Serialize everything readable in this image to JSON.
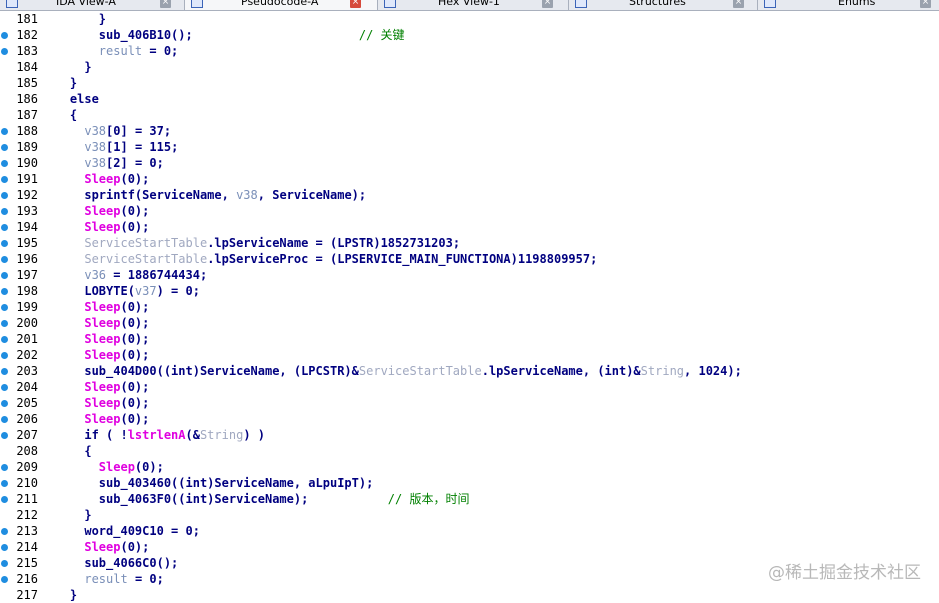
{
  "tabs": [
    {
      "label": "IDA View-A",
      "close": "×"
    },
    {
      "label": "Pseudocode-A",
      "close": "×"
    },
    {
      "label": "Hex View-1",
      "close": "×"
    },
    {
      "label": "Structures",
      "close": "×"
    },
    {
      "label": "Enums",
      "close": "×"
    }
  ],
  "lines": [
    {
      "n": "181",
      "bp": false,
      "t": [
        [
          "d",
          "        }"
        ]
      ]
    },
    {
      "n": "182",
      "bp": true,
      "t": [
        [
          "d",
          "        sub_406B10();"
        ],
        [
          "c",
          "                       // 关键"
        ]
      ]
    },
    {
      "n": "183",
      "bp": true,
      "t": [
        [
          "d",
          "        "
        ],
        [
          "v",
          "result"
        ],
        [
          "d",
          " = 0;"
        ]
      ]
    },
    {
      "n": "184",
      "bp": false,
      "t": [
        [
          "d",
          "      }"
        ]
      ]
    },
    {
      "n": "185",
      "bp": false,
      "t": [
        [
          "d",
          "    }"
        ]
      ]
    },
    {
      "n": "186",
      "bp": false,
      "t": [
        [
          "d",
          "    else"
        ]
      ]
    },
    {
      "n": "187",
      "bp": false,
      "t": [
        [
          "d",
          "    {"
        ]
      ]
    },
    {
      "n": "188",
      "bp": true,
      "t": [
        [
          "d",
          "      "
        ],
        [
          "v",
          "v38"
        ],
        [
          "d",
          "[0] = 37;"
        ]
      ]
    },
    {
      "n": "189",
      "bp": true,
      "t": [
        [
          "d",
          "      "
        ],
        [
          "v",
          "v38"
        ],
        [
          "d",
          "[1] = 115;"
        ]
      ]
    },
    {
      "n": "190",
      "bp": true,
      "t": [
        [
          "d",
          "      "
        ],
        [
          "v",
          "v38"
        ],
        [
          "d",
          "[2] = 0;"
        ]
      ]
    },
    {
      "n": "191",
      "bp": true,
      "t": [
        [
          "d",
          "      "
        ],
        [
          "f",
          "Sleep"
        ],
        [
          "d",
          "(0);"
        ]
      ]
    },
    {
      "n": "192",
      "bp": true,
      "t": [
        [
          "d",
          "      sprintf(ServiceName, "
        ],
        [
          "v",
          "v38"
        ],
        [
          "d",
          ", ServiceName);"
        ]
      ]
    },
    {
      "n": "193",
      "bp": true,
      "t": [
        [
          "d",
          "      "
        ],
        [
          "f",
          "Sleep"
        ],
        [
          "d",
          "(0);"
        ]
      ]
    },
    {
      "n": "194",
      "bp": true,
      "t": [
        [
          "d",
          "      "
        ],
        [
          "f",
          "Sleep"
        ],
        [
          "d",
          "(0);"
        ]
      ]
    },
    {
      "n": "195",
      "bp": true,
      "t": [
        [
          "d",
          "      "
        ],
        [
          "g",
          "ServiceStartTable"
        ],
        [
          "d",
          ".lpServiceName = (LPSTR)1852731203;"
        ]
      ]
    },
    {
      "n": "196",
      "bp": true,
      "t": [
        [
          "d",
          "      "
        ],
        [
          "g",
          "ServiceStartTable"
        ],
        [
          "d",
          ".lpServiceProc = (LPSERVICE_MAIN_FUNCTIONA)1198809957;"
        ]
      ]
    },
    {
      "n": "197",
      "bp": true,
      "t": [
        [
          "d",
          "      "
        ],
        [
          "v",
          "v36"
        ],
        [
          "d",
          " = 1886744434;"
        ]
      ]
    },
    {
      "n": "198",
      "bp": true,
      "t": [
        [
          "d",
          "      LOBYTE("
        ],
        [
          "v",
          "v37"
        ],
        [
          "d",
          ") = 0;"
        ]
      ]
    },
    {
      "n": "199",
      "bp": true,
      "t": [
        [
          "d",
          "      "
        ],
        [
          "f",
          "Sleep"
        ],
        [
          "d",
          "(0);"
        ]
      ]
    },
    {
      "n": "200",
      "bp": true,
      "t": [
        [
          "d",
          "      "
        ],
        [
          "f",
          "Sleep"
        ],
        [
          "d",
          "(0);"
        ]
      ]
    },
    {
      "n": "201",
      "bp": true,
      "t": [
        [
          "d",
          "      "
        ],
        [
          "f",
          "Sleep"
        ],
        [
          "d",
          "(0);"
        ]
      ]
    },
    {
      "n": "202",
      "bp": true,
      "t": [
        [
          "d",
          "      "
        ],
        [
          "f",
          "Sleep"
        ],
        [
          "d",
          "(0);"
        ]
      ]
    },
    {
      "n": "203",
      "bp": true,
      "t": [
        [
          "d",
          "      sub_404D00((int)ServiceName, (LPCSTR)&"
        ],
        [
          "g",
          "ServiceStartTable"
        ],
        [
          "d",
          ".lpServiceName, (int)&"
        ],
        [
          "g",
          "String"
        ],
        [
          "d",
          ", 1024);"
        ]
      ]
    },
    {
      "n": "204",
      "bp": true,
      "t": [
        [
          "d",
          "      "
        ],
        [
          "f",
          "Sleep"
        ],
        [
          "d",
          "(0);"
        ]
      ]
    },
    {
      "n": "205",
      "bp": true,
      "t": [
        [
          "d",
          "      "
        ],
        [
          "f",
          "Sleep"
        ],
        [
          "d",
          "(0);"
        ]
      ]
    },
    {
      "n": "206",
      "bp": true,
      "t": [
        [
          "d",
          "      "
        ],
        [
          "f",
          "Sleep"
        ],
        [
          "d",
          "(0);"
        ]
      ]
    },
    {
      "n": "207",
      "bp": true,
      "t": [
        [
          "d",
          "      if ( !"
        ],
        [
          "f",
          "lstrlenA"
        ],
        [
          "d",
          "(&"
        ],
        [
          "g",
          "String"
        ],
        [
          "d",
          ") )"
        ]
      ]
    },
    {
      "n": "208",
      "bp": false,
      "t": [
        [
          "d",
          "      {"
        ]
      ]
    },
    {
      "n": "209",
      "bp": true,
      "t": [
        [
          "d",
          "        "
        ],
        [
          "f",
          "Sleep"
        ],
        [
          "d",
          "(0);"
        ]
      ]
    },
    {
      "n": "210",
      "bp": true,
      "t": [
        [
          "d",
          "        sub_403460((int)ServiceName, aLpuIpT);"
        ]
      ]
    },
    {
      "n": "211",
      "bp": true,
      "t": [
        [
          "d",
          "        sub_4063F0((int)ServiceName);"
        ],
        [
          "c",
          "           // 版本，时间"
        ]
      ]
    },
    {
      "n": "212",
      "bp": false,
      "t": [
        [
          "d",
          "      }"
        ]
      ]
    },
    {
      "n": "213",
      "bp": true,
      "t": [
        [
          "d",
          "      word_409C10 = 0;"
        ]
      ]
    },
    {
      "n": "214",
      "bp": true,
      "t": [
        [
          "d",
          "      "
        ],
        [
          "f",
          "Sleep"
        ],
        [
          "d",
          "(0);"
        ]
      ]
    },
    {
      "n": "215",
      "bp": true,
      "t": [
        [
          "d",
          "      sub_4066C0();"
        ]
      ]
    },
    {
      "n": "216",
      "bp": true,
      "t": [
        [
          "d",
          "      "
        ],
        [
          "v",
          "result"
        ],
        [
          "d",
          " = 0;"
        ]
      ]
    },
    {
      "n": "217",
      "bp": false,
      "t": [
        [
          "d",
          "    }"
        ]
      ]
    }
  ],
  "watermark": "@稀土掘金技术社区"
}
